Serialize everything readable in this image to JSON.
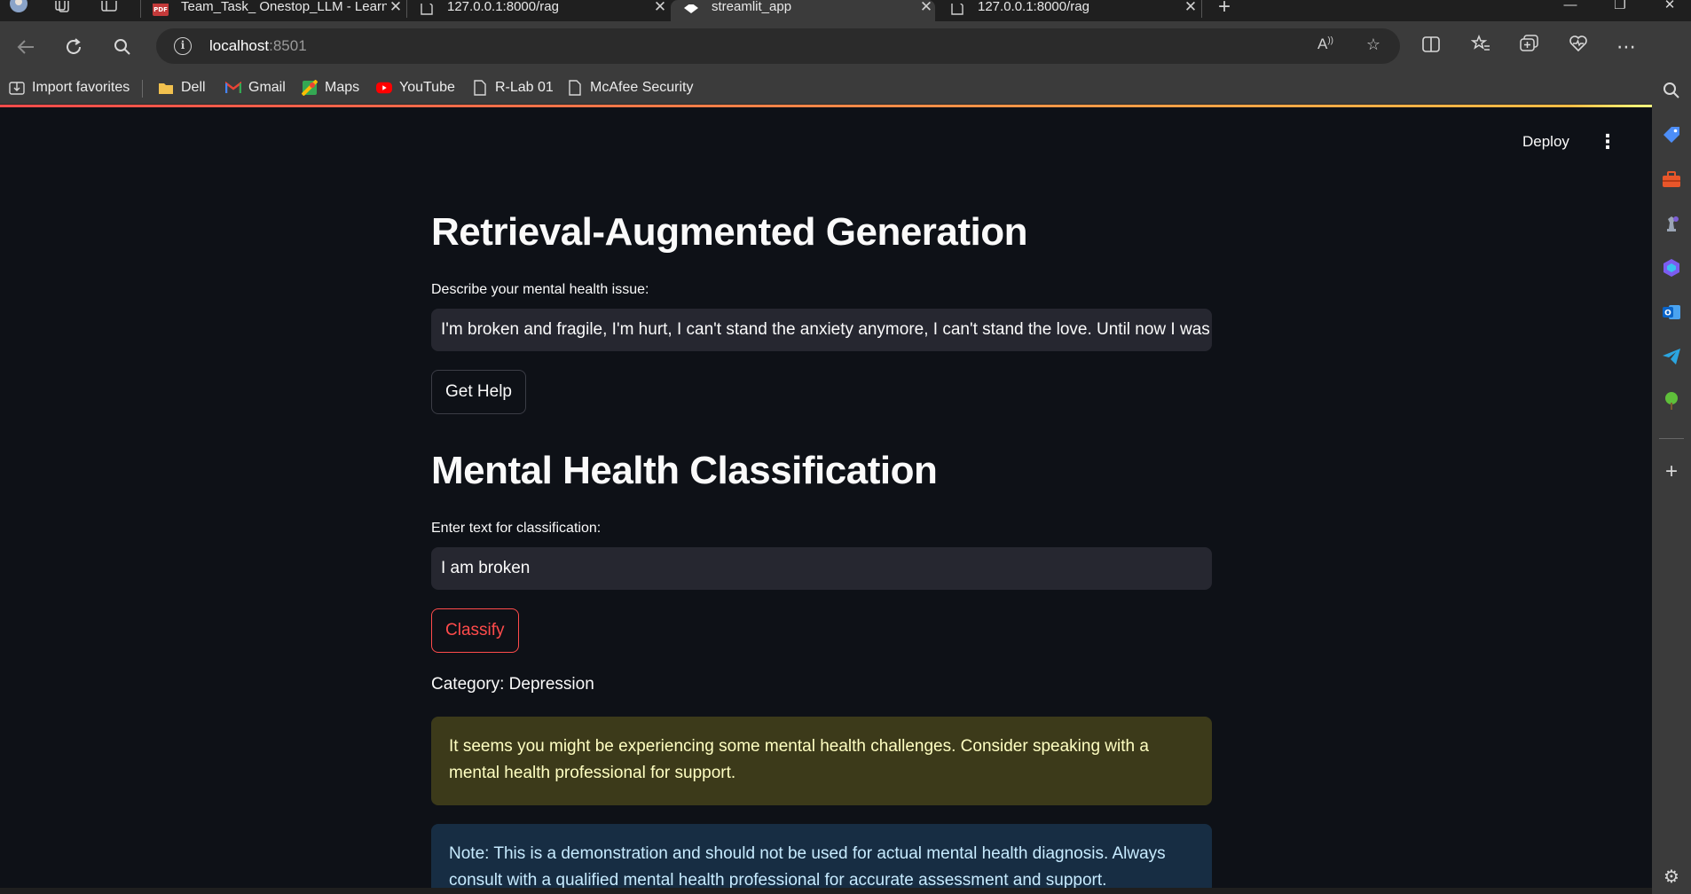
{
  "browser": {
    "tabs": [
      {
        "title": "Team_Task_ Onestop_LLM - Learn",
        "icon": "pdf-icon",
        "active": false
      },
      {
        "title": "127.0.0.1:8000/rag",
        "icon": "page-icon",
        "active": false
      },
      {
        "title": "streamlit_app",
        "icon": "streamlit-icon",
        "active": true
      },
      {
        "title": "127.0.0.1:8000/rag",
        "icon": "page-icon",
        "active": false
      }
    ],
    "address": {
      "host": "localhost",
      "port": ":8501"
    },
    "bookmarks": [
      {
        "label": "Import favorites",
        "icon": "import-icon"
      },
      {
        "label": "Dell",
        "icon": "folder-icon"
      },
      {
        "label": "Gmail",
        "icon": "gmail-icon"
      },
      {
        "label": "Maps",
        "icon": "maps-icon"
      },
      {
        "label": "YouTube",
        "icon": "youtube-icon"
      },
      {
        "label": "R-Lab 01",
        "icon": "page-icon"
      },
      {
        "label": "McAfee Security",
        "icon": "page-icon"
      }
    ]
  },
  "app": {
    "deploy_label": "Deploy",
    "rag": {
      "title": "Retrieval-Augmented Generation",
      "input_label": "Describe your mental health issue:",
      "input_value": "I'm broken and fragile, I'm hurt, I can't stand the anxiety anymore, I can't stand the love. Until now I was",
      "button_label": "Get Help"
    },
    "classification": {
      "title": "Mental Health Classification",
      "input_label": "Enter text for classification:",
      "input_value": "I am broken",
      "button_label": "Classify",
      "result": "Category: Depression",
      "warning_text": "It seems you might be experiencing some mental health challenges. Consider speaking with a mental health professional for support.",
      "note_text": "Note: This is a demonstration and should not be used for actual mental health diagnosis. Always consult with a qualified mental health professional for accurate assessment and support."
    }
  },
  "colors": {
    "app_background": "#0e1117",
    "accent_red": "#ff4b4b",
    "warning_bg": "#3c3a1a",
    "warning_text": "#ffffc2",
    "info_bg": "#172d43",
    "info_text": "#c7ebff"
  }
}
